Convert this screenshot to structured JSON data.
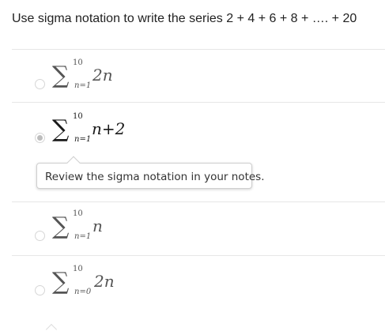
{
  "question": {
    "text": "Use sigma notation to write the series 2 + 4 + 6 + 8 + …. + 20"
  },
  "options": [
    {
      "sigma": "∑",
      "upper": "10",
      "lower": "n=1",
      "term": "2n",
      "selected": false
    },
    {
      "sigma": "∑",
      "upper": "10",
      "lower": "n=1",
      "term": "n+2",
      "selected": true
    },
    {
      "sigma": "∑",
      "upper": "10",
      "lower": "n=1",
      "term": "n",
      "selected": false
    },
    {
      "sigma": "∑",
      "upper": "10",
      "lower": "n=0",
      "term": "2n",
      "selected": false
    }
  ],
  "feedback": {
    "text": "Review the sigma notation in your notes."
  },
  "icons": {
    "radio": "radio-button-icon",
    "caret": "chevron-up-icon"
  },
  "colors": {
    "divider": "#e6e6e6",
    "radio_border": "#d6d6d6",
    "radio_checked": "#bdbdbd",
    "tooltip_border": "#cfcfcf"
  }
}
